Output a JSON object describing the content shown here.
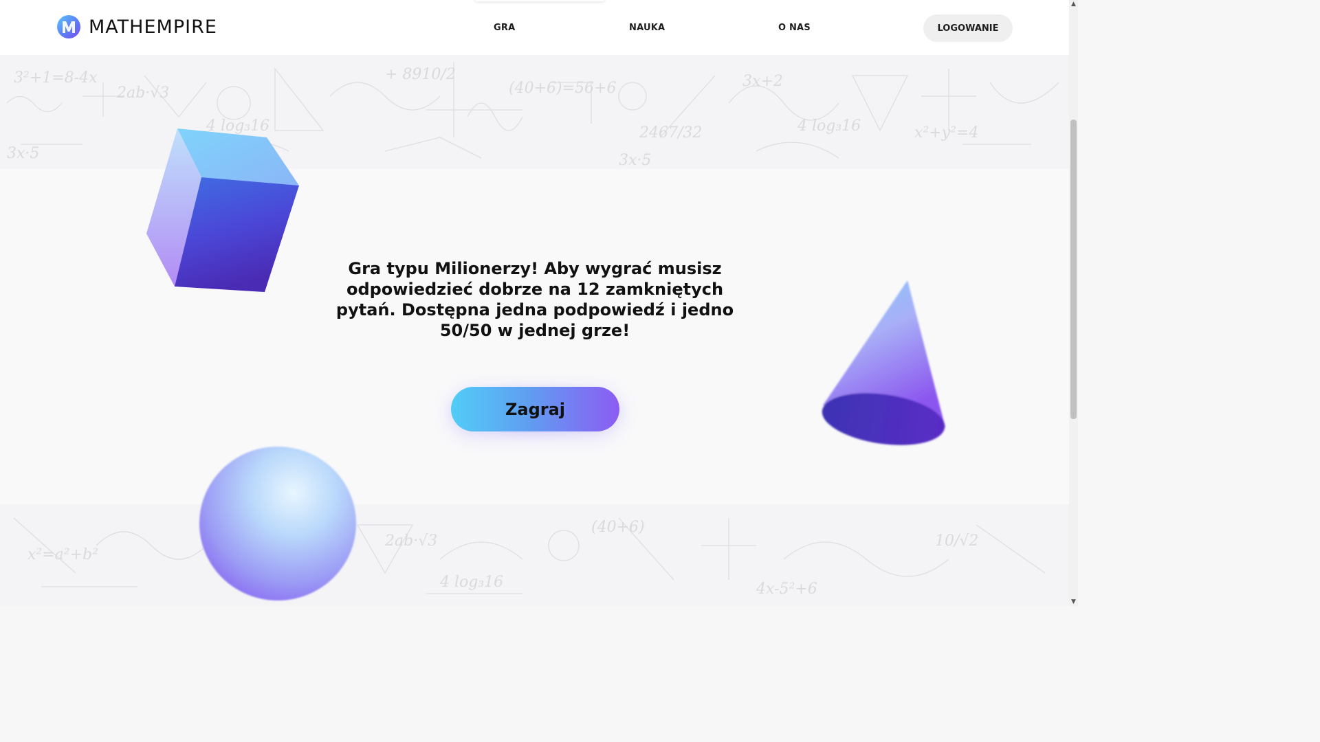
{
  "brand": {
    "name": "MATHEMPIRE",
    "logo_icon": "m-letter-logo-icon",
    "colors": {
      "accent_start": "#52cdf7",
      "accent_end": "#8c5cf3"
    }
  },
  "nav": {
    "items": [
      {
        "label": "GRA"
      },
      {
        "label": "NAUKA"
      },
      {
        "label": "O NAS"
      }
    ],
    "login_label": "LOGOWANIE"
  },
  "hero": {
    "headline": "Gra typu Milionerzy! Aby wygrać musisz odpowiedzieć dobrze na 12 zamkniętych pytań. Dostępna jedna podpowiedź i jedno 50/50 w jednej grze!",
    "play_label": "Zagraj"
  },
  "decorations": {
    "shapes": [
      "cube-icon",
      "cone-icon",
      "sphere-icon"
    ],
    "background": "math-formulas-pattern"
  }
}
